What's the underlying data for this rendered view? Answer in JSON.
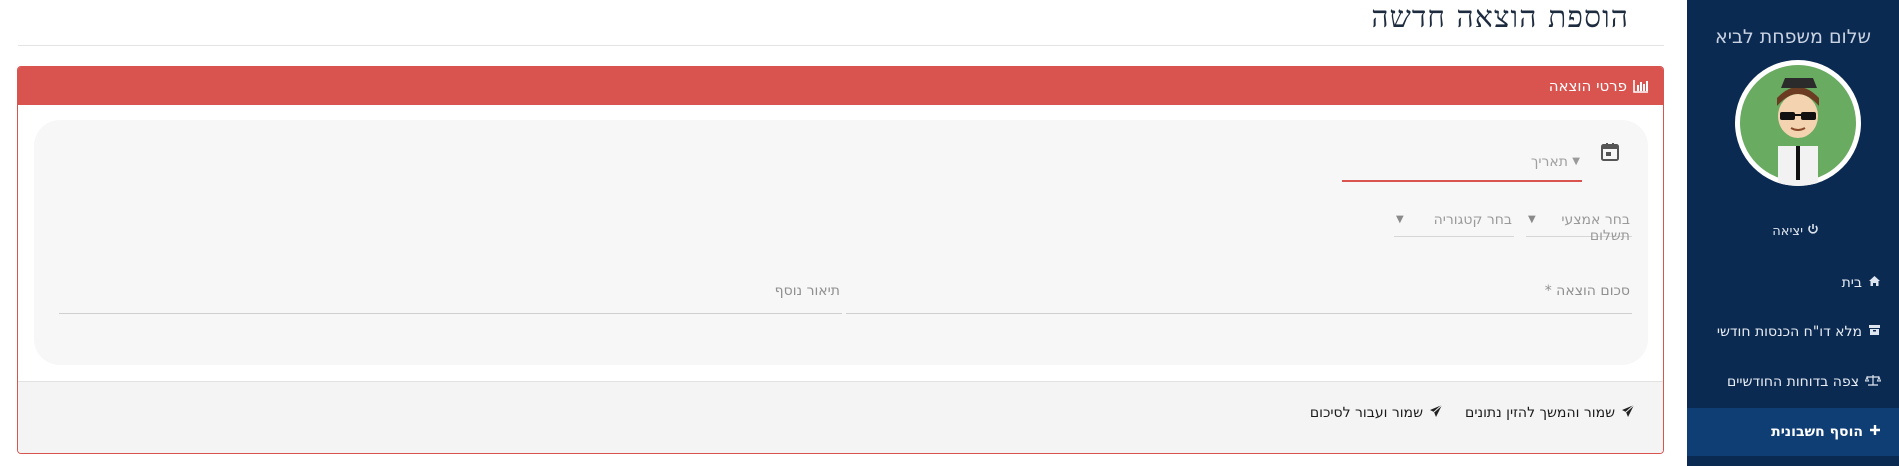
{
  "sidebar": {
    "greeting": "שלום משפחת לביא",
    "logout_label": "יציאה",
    "items": [
      {
        "label": "בית",
        "icon": "home-icon"
      },
      {
        "label": "מלא דו\"ח הכנסות חודשי",
        "icon": "archive-icon"
      },
      {
        "label": "צפה בדוחות החודשיים",
        "icon": "scale-icon"
      },
      {
        "label": "הוסף חשבונית",
        "icon": "plus-icon",
        "active": true
      }
    ],
    "colors": {
      "background": "#0b2a52",
      "active": "#0f3e74"
    }
  },
  "main": {
    "title": "הוספת הוצאה חדשה",
    "panel": {
      "header": "פרטי הוצאה",
      "header_icon": "bar-chart-icon",
      "accent_color": "#d9534f",
      "date_placeholder": "תאריך",
      "payment_placeholder": "בחר אמצעי תשלום",
      "category_placeholder": "בחר קטגוריה",
      "amount_label": "סכום הוצאה *",
      "description_label": "תיאור נוסף",
      "buttons": {
        "save_continue": "שמור והמשך להזין נתונים",
        "save_summary": "שמור ועבור לסיכום"
      }
    }
  }
}
